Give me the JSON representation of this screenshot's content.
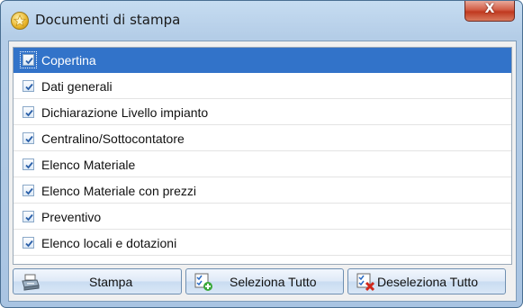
{
  "window": {
    "title": "Documenti di stampa",
    "close_label": "X"
  },
  "documents": [
    {
      "label": "Copertina",
      "checked": true,
      "selected": true
    },
    {
      "label": "Dati generali",
      "checked": true,
      "selected": false
    },
    {
      "label": "Dichiarazione Livello impianto",
      "checked": true,
      "selected": false
    },
    {
      "label": "Centralino/Sottocontatore",
      "checked": true,
      "selected": false
    },
    {
      "label": "Elenco Materiale",
      "checked": true,
      "selected": false
    },
    {
      "label": "Elenco Materiale con prezzi",
      "checked": true,
      "selected": false
    },
    {
      "label": "Preventivo",
      "checked": true,
      "selected": false
    },
    {
      "label": "Elenco locali e dotazioni",
      "checked": true,
      "selected": false
    }
  ],
  "buttons": {
    "print": {
      "label": "Stampa",
      "icon": "printer-icon"
    },
    "select_all": {
      "label": "Seleziona Tutto",
      "icon": "check-add-icon"
    },
    "deselect_all": {
      "label": "Deseleziona Tutto",
      "icon": "check-remove-icon"
    }
  },
  "colors": {
    "selection": "#3273c9",
    "title_bar": "#b4cde7",
    "close_button": "#c0391f"
  }
}
